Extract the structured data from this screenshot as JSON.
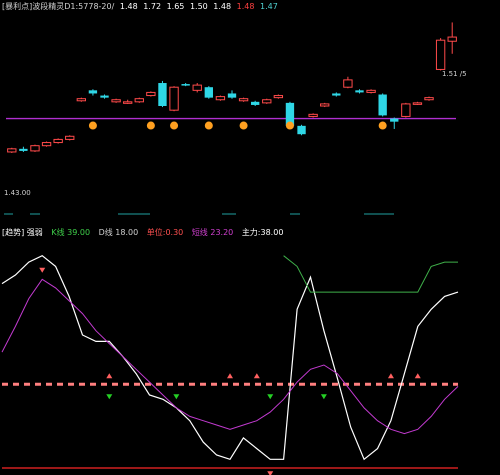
{
  "colors": {
    "bg": "#000000",
    "up": "#ff4a4a",
    "down": "#2fd7e6",
    "baseline": "#b02fd0",
    "k_line": "#ffffff",
    "d_line": "#c23ad0",
    "upper_band": "#3fb04a",
    "mid_line": "#ff7f7f",
    "bottom_line": "#d02020",
    "marker_orange": "#ffa020",
    "signal_green": "#25d025",
    "dash_teal": "#1f9f9f"
  },
  "header_top": {
    "title": "[暴利点]波段精灵D1:5778-20/",
    "values": [
      "1.48",
      "1.72",
      "1.65",
      "1.50",
      "1.48"
    ],
    "mid": "1.48",
    "cyan_text": "1.47"
  },
  "upper_panel": {
    "high_label": "1.51 /5",
    "low_label": "1.43.00",
    "baseline_value": 1.478,
    "price_range": [
      1.4,
      1.58
    ]
  },
  "header_bottom": {
    "title": "[趋势] 强弱",
    "k_label": "K线 39.00",
    "d_label": "D线 18.00",
    "extra_label": "单位:0.30",
    "gap_label": "短线 23.20",
    "end_label": "主力:38.00"
  },
  "chart_data": [
    {
      "type": "candlestick",
      "panel": "price",
      "candles": [
        {
          "o": 1.446,
          "c": 1.449,
          "h": 1.45,
          "l": 1.445
        },
        {
          "o": 1.449,
          "c": 1.447,
          "h": 1.451,
          "l": 1.446
        },
        {
          "o": 1.447,
          "c": 1.452,
          "h": 1.453,
          "l": 1.446
        },
        {
          "o": 1.452,
          "c": 1.455,
          "h": 1.456,
          "l": 1.451
        },
        {
          "o": 1.455,
          "c": 1.458,
          "h": 1.459,
          "l": 1.454
        },
        {
          "o": 1.458,
          "c": 1.461,
          "h": 1.462,
          "l": 1.457
        },
        {
          "o": 1.495,
          "c": 1.497,
          "h": 1.498,
          "l": 1.494
        },
        {
          "o": 1.505,
          "c": 1.502,
          "h": 1.506,
          "l": 1.5
        },
        {
          "o": 1.5,
          "c": 1.498,
          "h": 1.501,
          "l": 1.497
        },
        {
          "o": 1.494,
          "c": 1.496,
          "h": 1.497,
          "l": 1.493
        },
        {
          "o": 1.493,
          "c": 1.494,
          "h": 1.496,
          "l": 1.492
        },
        {
          "o": 1.494,
          "c": 1.497,
          "h": 1.498,
          "l": 1.493
        },
        {
          "o": 1.5,
          "c": 1.503,
          "h": 1.504,
          "l": 1.499
        },
        {
          "o": 1.512,
          "c": 1.49,
          "h": 1.514,
          "l": 1.489
        },
        {
          "o": 1.486,
          "c": 1.508,
          "h": 1.509,
          "l": 1.485
        },
        {
          "o": 1.511,
          "c": 1.51,
          "h": 1.512,
          "l": 1.509
        },
        {
          "o": 1.505,
          "c": 1.51,
          "h": 1.512,
          "l": 1.503
        },
        {
          "o": 1.508,
          "c": 1.498,
          "h": 1.509,
          "l": 1.497
        },
        {
          "o": 1.496,
          "c": 1.499,
          "h": 1.5,
          "l": 1.495
        },
        {
          "o": 1.502,
          "c": 1.498,
          "h": 1.505,
          "l": 1.497
        },
        {
          "o": 1.495,
          "c": 1.497,
          "h": 1.498,
          "l": 1.494
        },
        {
          "o": 1.494,
          "c": 1.491,
          "h": 1.495,
          "l": 1.49
        },
        {
          "o": 1.493,
          "c": 1.496,
          "h": 1.497,
          "l": 1.492
        },
        {
          "o": 1.498,
          "c": 1.5,
          "h": 1.501,
          "l": 1.497
        },
        {
          "o": 1.493,
          "c": 1.471,
          "h": 1.494,
          "l": 1.47
        },
        {
          "o": 1.471,
          "c": 1.463,
          "h": 1.472,
          "l": 1.462
        },
        {
          "o": 1.48,
          "c": 1.482,
          "h": 1.483,
          "l": 1.479
        },
        {
          "o": 1.49,
          "c": 1.492,
          "h": 1.493,
          "l": 1.489
        },
        {
          "o": 1.502,
          "c": 1.5,
          "h": 1.503,
          "l": 1.499
        },
        {
          "o": 1.508,
          "c": 1.515,
          "h": 1.518,
          "l": 1.507
        },
        {
          "o": 1.505,
          "c": 1.503,
          "h": 1.506,
          "l": 1.502
        },
        {
          "o": 1.503,
          "c": 1.505,
          "h": 1.506,
          "l": 1.502
        },
        {
          "o": 1.501,
          "c": 1.481,
          "h": 1.502,
          "l": 1.48
        },
        {
          "o": 1.478,
          "c": 1.475,
          "h": 1.479,
          "l": 1.468
        },
        {
          "o": 1.48,
          "c": 1.492,
          "h": 1.493,
          "l": 1.479
        },
        {
          "o": 1.492,
          "c": 1.493,
          "h": 1.494,
          "l": 1.491
        },
        {
          "o": 1.496,
          "c": 1.498,
          "h": 1.499,
          "l": 1.495
        },
        {
          "o": 1.525,
          "c": 1.553,
          "h": 1.555,
          "l": 1.524
        },
        {
          "o": 1.552,
          "c": 1.556,
          "h": 1.57,
          "l": 1.54
        }
      ],
      "marker_candles": [
        7,
        12,
        14,
        17,
        20,
        24,
        32
      ]
    },
    {
      "type": "line",
      "panel": "indicator",
      "ylim": [
        -5,
        100
      ],
      "series": [
        {
          "values": [
            82,
            86,
            92,
            95,
            90,
            76,
            58,
            55,
            55,
            48,
            40,
            30,
            28,
            24,
            18,
            8,
            2,
            0,
            10,
            5,
            0,
            0,
            70,
            85,
            60,
            38,
            15,
            0,
            5,
            18,
            40,
            62,
            70,
            76,
            78
          ]
        },
        {
          "values": [
            50,
            62,
            75,
            84,
            80,
            74,
            68,
            60,
            54,
            48,
            42,
            36,
            30,
            24,
            20,
            18,
            16,
            14,
            16,
            18,
            22,
            28,
            36,
            42,
            44,
            40,
            32,
            24,
            18,
            14,
            12,
            14,
            20,
            28,
            34
          ]
        },
        {
          "values": [
            null,
            null,
            null,
            null,
            null,
            null,
            null,
            null,
            null,
            null,
            null,
            null,
            null,
            null,
            null,
            null,
            null,
            null,
            null,
            null,
            null,
            95,
            90,
            78,
            78,
            78,
            78,
            78,
            78,
            78,
            78,
            78,
            90,
            92,
            92
          ]
        }
      ],
      "mid_value": 35,
      "down_arrows": [
        3,
        20
      ],
      "up_arrows": [
        8,
        17,
        19,
        29,
        31
      ],
      "green_signals": [
        8,
        13,
        20,
        24
      ]
    }
  ]
}
